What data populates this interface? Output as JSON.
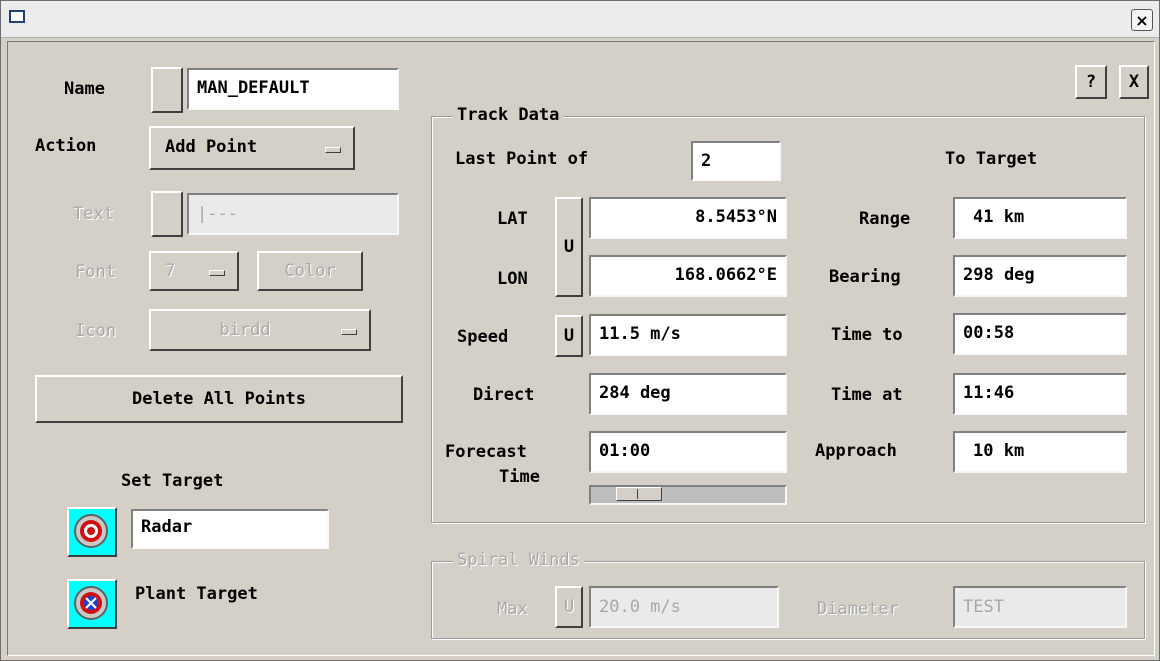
{
  "window": {
    "close_glyph": "×"
  },
  "left": {
    "name_label": "Name",
    "name_value": "MAN_DEFAULT",
    "action_label": "Action",
    "action_value": "Add Point",
    "text_label": "Text",
    "text_value": "|---",
    "font_label": "Font",
    "font_value": "7",
    "color_button": "Color",
    "icon_label": "Icon",
    "icon_value": "birdd",
    "delete_all_button": "Delete All Points",
    "set_target_label": "Set Target",
    "target_value": "Radar",
    "plant_target_label": "Plant Target"
  },
  "top_buttons": {
    "help": "?",
    "close": "X"
  },
  "track": {
    "group_title": "Track Data",
    "last_point_label": "Last Point of",
    "last_point_value": "2",
    "to_target_label": "To Target",
    "lat_label": "LAT",
    "lat_value": "8.5453°N",
    "lon_label": "LON",
    "lon_value": "168.0662°E",
    "u_label": "U",
    "speed_label": "Speed",
    "speed_value": "11.5 m/s",
    "direct_label": "Direct",
    "direct_value": "284 deg",
    "forecast_label_1": "Forecast",
    "forecast_label_2": "Time",
    "forecast_value": "01:00",
    "range_label": "Range",
    "range_value": "41 km",
    "bearing_label": "Bearing",
    "bearing_value": "298 deg",
    "time_to_label": "Time to",
    "time_to_value": "00:58",
    "time_at_label": "Time at",
    "time_at_value": "11:46",
    "approach_label": "Approach",
    "approach_value": "10 km"
  },
  "spiral": {
    "group_title": "Spiral Winds",
    "max_label": "Max",
    "u_label": "U",
    "max_value": "20.0 m/s",
    "diameter_label": "Diameter",
    "diameter_value": "TEST"
  },
  "colors": {
    "target_button_bg": "#00ffff",
    "radar_red": "#d01010",
    "plant_blue": "#2040d0"
  }
}
